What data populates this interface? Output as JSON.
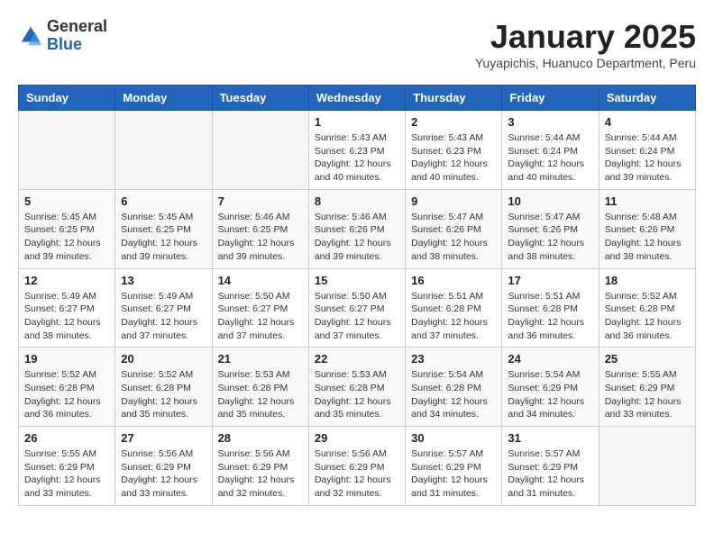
{
  "logo": {
    "general": "General",
    "blue": "Blue"
  },
  "title": "January 2025",
  "location": "Yuyapichis, Huanuco Department, Peru",
  "weekdays": [
    "Sunday",
    "Monday",
    "Tuesday",
    "Wednesday",
    "Thursday",
    "Friday",
    "Saturday"
  ],
  "weeks": [
    [
      {
        "day": "",
        "info": ""
      },
      {
        "day": "",
        "info": ""
      },
      {
        "day": "",
        "info": ""
      },
      {
        "day": "1",
        "info": "Sunrise: 5:43 AM\nSunset: 6:23 PM\nDaylight: 12 hours and 40 minutes."
      },
      {
        "day": "2",
        "info": "Sunrise: 5:43 AM\nSunset: 6:23 PM\nDaylight: 12 hours and 40 minutes."
      },
      {
        "day": "3",
        "info": "Sunrise: 5:44 AM\nSunset: 6:24 PM\nDaylight: 12 hours and 40 minutes."
      },
      {
        "day": "4",
        "info": "Sunrise: 5:44 AM\nSunset: 6:24 PM\nDaylight: 12 hours and 39 minutes."
      }
    ],
    [
      {
        "day": "5",
        "info": "Sunrise: 5:45 AM\nSunset: 6:25 PM\nDaylight: 12 hours and 39 minutes."
      },
      {
        "day": "6",
        "info": "Sunrise: 5:45 AM\nSunset: 6:25 PM\nDaylight: 12 hours and 39 minutes."
      },
      {
        "day": "7",
        "info": "Sunrise: 5:46 AM\nSunset: 6:25 PM\nDaylight: 12 hours and 39 minutes."
      },
      {
        "day": "8",
        "info": "Sunrise: 5:46 AM\nSunset: 6:26 PM\nDaylight: 12 hours and 39 minutes."
      },
      {
        "day": "9",
        "info": "Sunrise: 5:47 AM\nSunset: 6:26 PM\nDaylight: 12 hours and 38 minutes."
      },
      {
        "day": "10",
        "info": "Sunrise: 5:47 AM\nSunset: 6:26 PM\nDaylight: 12 hours and 38 minutes."
      },
      {
        "day": "11",
        "info": "Sunrise: 5:48 AM\nSunset: 6:26 PM\nDaylight: 12 hours and 38 minutes."
      }
    ],
    [
      {
        "day": "12",
        "info": "Sunrise: 5:49 AM\nSunset: 6:27 PM\nDaylight: 12 hours and 38 minutes."
      },
      {
        "day": "13",
        "info": "Sunrise: 5:49 AM\nSunset: 6:27 PM\nDaylight: 12 hours and 37 minutes."
      },
      {
        "day": "14",
        "info": "Sunrise: 5:50 AM\nSunset: 6:27 PM\nDaylight: 12 hours and 37 minutes."
      },
      {
        "day": "15",
        "info": "Sunrise: 5:50 AM\nSunset: 6:27 PM\nDaylight: 12 hours and 37 minutes."
      },
      {
        "day": "16",
        "info": "Sunrise: 5:51 AM\nSunset: 6:28 PM\nDaylight: 12 hours and 37 minutes."
      },
      {
        "day": "17",
        "info": "Sunrise: 5:51 AM\nSunset: 6:28 PM\nDaylight: 12 hours and 36 minutes."
      },
      {
        "day": "18",
        "info": "Sunrise: 5:52 AM\nSunset: 6:28 PM\nDaylight: 12 hours and 36 minutes."
      }
    ],
    [
      {
        "day": "19",
        "info": "Sunrise: 5:52 AM\nSunset: 6:28 PM\nDaylight: 12 hours and 36 minutes."
      },
      {
        "day": "20",
        "info": "Sunrise: 5:52 AM\nSunset: 6:28 PM\nDaylight: 12 hours and 35 minutes."
      },
      {
        "day": "21",
        "info": "Sunrise: 5:53 AM\nSunset: 6:28 PM\nDaylight: 12 hours and 35 minutes."
      },
      {
        "day": "22",
        "info": "Sunrise: 5:53 AM\nSunset: 6:28 PM\nDaylight: 12 hours and 35 minutes."
      },
      {
        "day": "23",
        "info": "Sunrise: 5:54 AM\nSunset: 6:28 PM\nDaylight: 12 hours and 34 minutes."
      },
      {
        "day": "24",
        "info": "Sunrise: 5:54 AM\nSunset: 6:29 PM\nDaylight: 12 hours and 34 minutes."
      },
      {
        "day": "25",
        "info": "Sunrise: 5:55 AM\nSunset: 6:29 PM\nDaylight: 12 hours and 33 minutes."
      }
    ],
    [
      {
        "day": "26",
        "info": "Sunrise: 5:55 AM\nSunset: 6:29 PM\nDaylight: 12 hours and 33 minutes."
      },
      {
        "day": "27",
        "info": "Sunrise: 5:56 AM\nSunset: 6:29 PM\nDaylight: 12 hours and 33 minutes."
      },
      {
        "day": "28",
        "info": "Sunrise: 5:56 AM\nSunset: 6:29 PM\nDaylight: 12 hours and 32 minutes."
      },
      {
        "day": "29",
        "info": "Sunrise: 5:56 AM\nSunset: 6:29 PM\nDaylight: 12 hours and 32 minutes."
      },
      {
        "day": "30",
        "info": "Sunrise: 5:57 AM\nSunset: 6:29 PM\nDaylight: 12 hours and 31 minutes."
      },
      {
        "day": "31",
        "info": "Sunrise: 5:57 AM\nSunset: 6:29 PM\nDaylight: 12 hours and 31 minutes."
      },
      {
        "day": "",
        "info": ""
      }
    ]
  ]
}
